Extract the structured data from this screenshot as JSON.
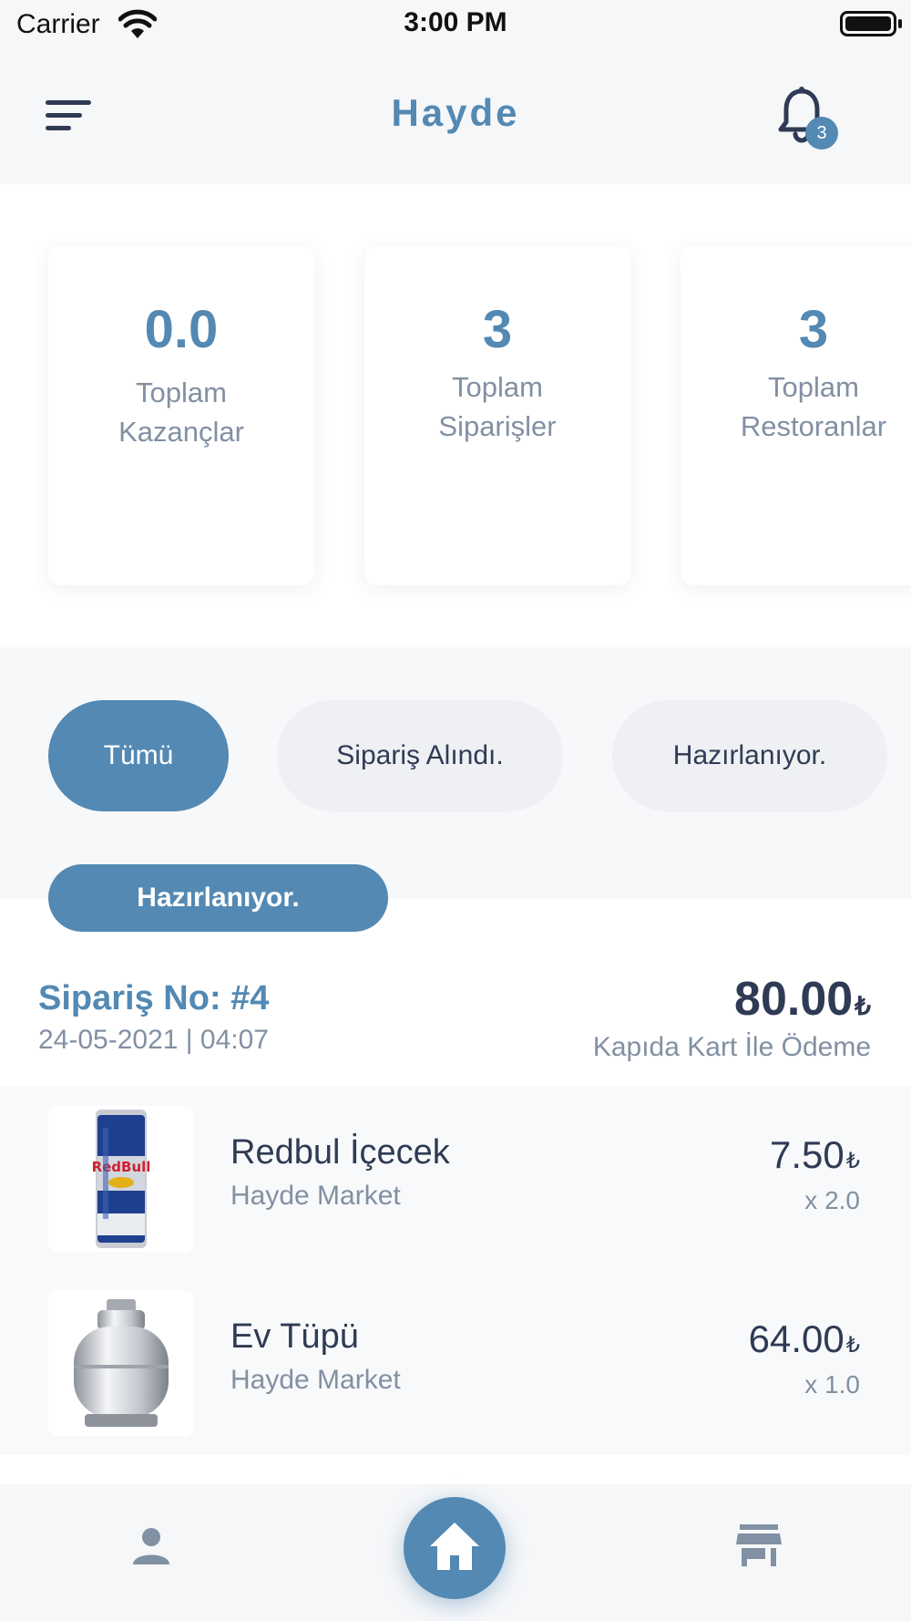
{
  "status_bar": {
    "carrier": "Carrier",
    "time": "3:00 PM"
  },
  "header": {
    "title": "Hayde",
    "notification_count": "3"
  },
  "stats": [
    {
      "value": "0.0",
      "label_line1": "Toplam",
      "label_line2": "Kazançlar"
    },
    {
      "value": "3",
      "label_line1": "Toplam",
      "label_line2": "Siparişler"
    },
    {
      "value": "3",
      "label_line1": "Toplam",
      "label_line2": "Restoranlar"
    }
  ],
  "filters": [
    {
      "label": "Tümü",
      "active": true
    },
    {
      "label": "Sipariş Alındı.",
      "active": false
    },
    {
      "label": "Hazırlanıyor.",
      "active": false
    }
  ],
  "order": {
    "status": "Hazırlanıyor.",
    "number": "Sipariş No: #4",
    "date": "24-05-2021 | 04:07",
    "total": "80.00",
    "currency": "₺",
    "payment": "Kapıda Kart İle Ödeme",
    "items": [
      {
        "name": "Redbul İçecek",
        "store": "Hayde Market",
        "price": "7.50",
        "qty": "x 2.0",
        "image_icon": "redbull-can-icon"
      },
      {
        "name": "Ev Tüpü",
        "store": "Hayde Market",
        "price": "64.00",
        "qty": "x 1.0",
        "image_icon": "gas-cylinder-icon"
      }
    ]
  },
  "colors": {
    "accent": "#5389b3",
    "text_dark": "#2f3b55",
    "text_muted": "#8290a3"
  },
  "bottom_nav": {
    "left_icon": "profile-icon",
    "center_icon": "home-icon",
    "right_icon": "store-icon"
  }
}
